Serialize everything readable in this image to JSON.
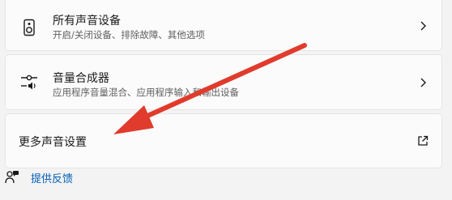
{
  "items": [
    {
      "title": "所有声音设备",
      "subtitle": "开启/关闭设备、排除故障、其他选项",
      "icon": "speaker-icon"
    },
    {
      "title": "音量合成器",
      "subtitle": "应用程序音量混合、应用程序输入和输出设备",
      "icon": "volume-mixer-icon"
    }
  ],
  "more": {
    "title": "更多声音设置",
    "icon": "open-external-icon"
  },
  "feedback": {
    "label": "提供反馈",
    "icon": "feedback-icon"
  },
  "colors": {
    "arrow": "#e03b2c",
    "link": "#005fb8"
  }
}
